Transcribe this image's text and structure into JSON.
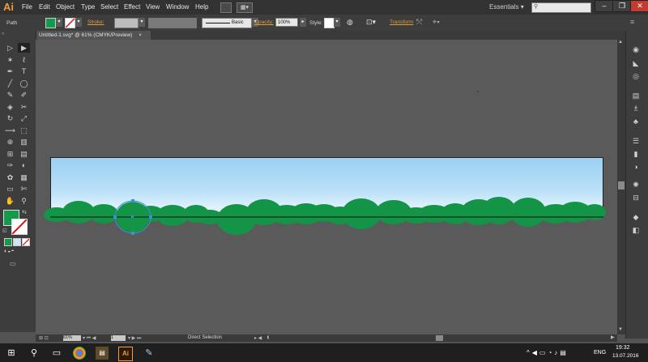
{
  "app": {
    "logo": "Ai",
    "menu": [
      "File",
      "Edit",
      "Object",
      "Type",
      "Select",
      "Effect",
      "View",
      "Window",
      "Help"
    ],
    "workspace": "Essentials",
    "window_controls": [
      "–",
      "❐",
      "✕"
    ]
  },
  "control_bar": {
    "object_type": "Path",
    "stroke_label": "Stroke:",
    "brush_style": "Basic",
    "opacity_label": "Opacity:",
    "opacity_value": "100%",
    "style_label": "Style:",
    "transform_label": "Transform",
    "fill_color": "#159a4b"
  },
  "document": {
    "tab_title": "Untitled-1.svg* @ 61% (CMYK/Preview)",
    "tab_close": "×"
  },
  "tools_icons": [
    "selection-tool-icon",
    "direct-selection-tool-icon",
    "magic-wand-tool-icon",
    "lasso-tool-icon",
    "pen-tool-icon",
    "type-tool-icon",
    "line-tool-icon",
    "ellipse-tool-icon",
    "paintbrush-tool-icon",
    "pencil-tool-icon",
    "blob-brush-tool-icon",
    "eraser-tool-icon",
    "rotate-tool-icon",
    "scale-tool-icon",
    "width-tool-icon",
    "free-transform-tool-icon",
    "shape-builder-tool-icon",
    "perspective-grid-tool-icon",
    "mesh-tool-icon",
    "gradient-tool-icon",
    "eyedropper-tool-icon",
    "blend-tool-icon",
    "symbol-sprayer-tool-icon",
    "column-graph-tool-icon",
    "artboard-tool-icon",
    "slice-tool-icon",
    "hand-tool-icon",
    "zoom-tool-icon"
  ],
  "tools_glyphs": [
    "▷",
    "▶",
    "✶",
    "ℓ",
    "✒",
    "T",
    "╱",
    "◯",
    "✎",
    "✐",
    "◈",
    "✂",
    "↻",
    "⤢",
    "⟿",
    "⬚",
    "⊕",
    "▥",
    "⊞",
    "▤",
    "✑",
    "◐",
    "✿",
    "▦",
    "▭",
    "✄",
    "✋",
    "⚲"
  ],
  "panel_icons": [
    "color-guide-icon",
    "color-panel-icon",
    "appearance-icon",
    "libraries-icon",
    "brushes-icon",
    "symbols-icon",
    "stroke-icon",
    "gradient-panel-icon",
    "transparency-icon",
    "graphic-styles-icon",
    "align-icon",
    "layers-icon",
    "artboards-icon"
  ],
  "panel_glyphs": [
    "◉",
    "◣",
    "◎",
    "▤",
    "♗",
    "♣",
    "☰",
    "▮",
    "◑",
    "✺",
    "⊟",
    "◆",
    "◧"
  ],
  "status_bar": {
    "zoom": "61%",
    "page": "1",
    "mode": "Direct Selection"
  },
  "artwork": {
    "sky_top": "#9bd0f2",
    "sky_bottom": "#f4fbff",
    "bush_color": "#149447",
    "selection_color": "#3c8fd4"
  },
  "taskbar": {
    "language": "ENG",
    "time": "19:32",
    "date": "13.07.2016"
  }
}
